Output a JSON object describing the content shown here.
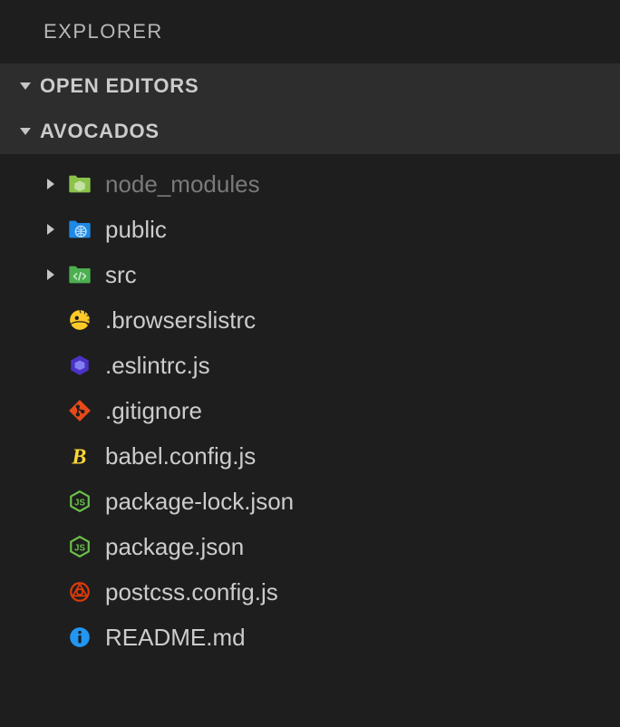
{
  "panel": {
    "title": "EXPLORER"
  },
  "sections": {
    "openEditors": {
      "label": "OPEN EDITORS"
    },
    "workspace": {
      "label": "AVOCADOS"
    }
  },
  "tree": [
    {
      "name": "node_modules",
      "kind": "folder",
      "icon": "folder-node",
      "dimmed": true
    },
    {
      "name": "public",
      "kind": "folder",
      "icon": "folder-public",
      "dimmed": false
    },
    {
      "name": "src",
      "kind": "folder",
      "icon": "folder-src",
      "dimmed": false
    },
    {
      "name": ".browserslistrc",
      "kind": "file",
      "icon": "browserslist"
    },
    {
      "name": ".eslintrc.js",
      "kind": "file",
      "icon": "eslint"
    },
    {
      "name": ".gitignore",
      "kind": "file",
      "icon": "git"
    },
    {
      "name": "babel.config.js",
      "kind": "file",
      "icon": "babel"
    },
    {
      "name": "package-lock.json",
      "kind": "file",
      "icon": "npm"
    },
    {
      "name": "package.json",
      "kind": "file",
      "icon": "npm"
    },
    {
      "name": "postcss.config.js",
      "kind": "file",
      "icon": "postcss"
    },
    {
      "name": "README.md",
      "kind": "file",
      "icon": "info"
    }
  ],
  "colors": {
    "folderNode": "#8bc34a",
    "folderPublic": "#1e88e5",
    "folderSrc": "#4caf50",
    "browserslist": "#ffca28",
    "eslint": "#4b32c3",
    "git": "#e64a19",
    "babel": "#fdd835",
    "npm": "#6cc24a",
    "postcss": "#dd3a0a",
    "info": "#2196f3"
  }
}
